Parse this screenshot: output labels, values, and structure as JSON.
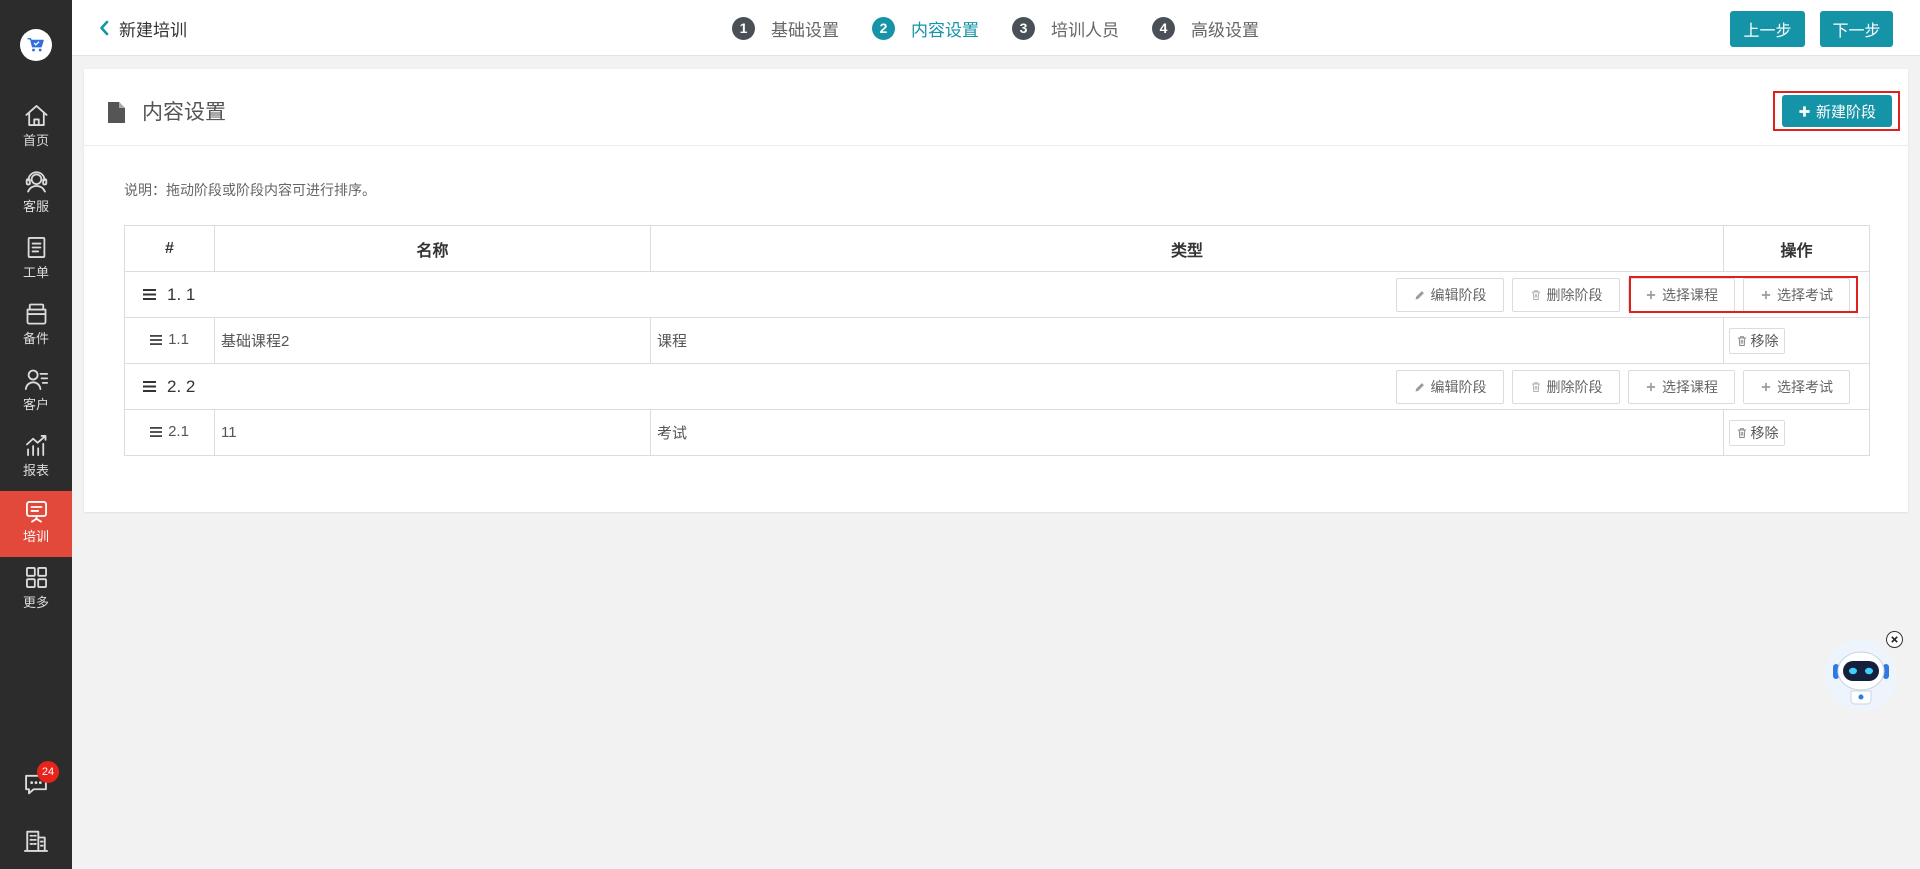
{
  "colors": {
    "accent": "#1594a8",
    "sidebar_bg": "#2c2c2c",
    "nav_active": "#e2493a",
    "step_inactive": "#4a5058",
    "badge": "#e8231b",
    "highlight": "#e0201e"
  },
  "sidebar": {
    "logo_icon": "cart-icon",
    "items": [
      {
        "label": "首页",
        "icon": "home-icon",
        "active": false
      },
      {
        "label": "客服",
        "icon": "headset-icon",
        "active": false
      },
      {
        "label": "工单",
        "icon": "clipboard-icon",
        "active": false
      },
      {
        "label": "备件",
        "icon": "box-icon",
        "active": false
      },
      {
        "label": "客户",
        "icon": "customer-icon",
        "active": false
      },
      {
        "label": "报表",
        "icon": "chart-icon",
        "active": false
      },
      {
        "label": "培训",
        "icon": "training-icon",
        "active": true
      },
      {
        "label": "更多",
        "icon": "grid-icon",
        "active": false
      }
    ],
    "footer": {
      "messages_icon": "chat-icon",
      "messages_badge": "24",
      "org_icon": "building-icon"
    }
  },
  "header": {
    "back_icon": "chevron-left-icon",
    "title": "新建培训",
    "steps": [
      {
        "number": "1",
        "label": "基础设置",
        "active": false
      },
      {
        "number": "2",
        "label": "内容设置",
        "active": true
      },
      {
        "number": "3",
        "label": "培训人员",
        "active": false
      },
      {
        "number": "4",
        "label": "高级设置",
        "active": false
      }
    ],
    "prev_button": "上一步",
    "next_button": "下一步"
  },
  "content_settings": {
    "icon": "document-icon",
    "title": "内容设置",
    "new_stage_button": "新建阶段",
    "note": "说明：拖动阶段或阶段内容可进行排序。",
    "columns": [
      "#",
      "名称",
      "类型",
      "操作"
    ],
    "stage_actions": {
      "edit": "编辑阶段",
      "delete": "删除阶段",
      "select_course": "选择课程",
      "select_exam": "选择考试"
    },
    "remove_label": "移除",
    "stages": [
      {
        "label": "1. 1",
        "items": [
          {
            "index": "1.1",
            "name": "基础课程2",
            "type": "课程"
          }
        ]
      },
      {
        "label": "2. 2",
        "items": [
          {
            "index": "2.1",
            "name": "11",
            "type": "考试"
          }
        ]
      }
    ]
  },
  "assistant": {
    "icon": "robot-assistant-icon",
    "close_icon": "close-icon"
  }
}
